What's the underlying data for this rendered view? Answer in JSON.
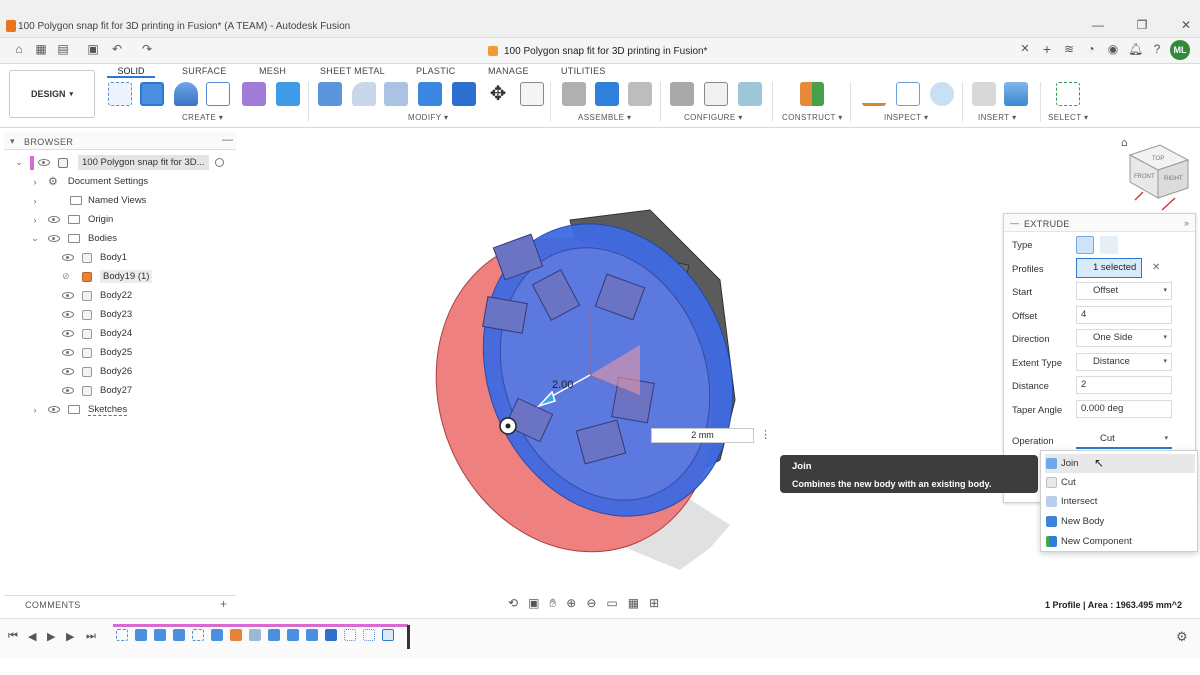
{
  "window": {
    "title": "100 Polygon snap fit for 3D printing in Fusion* (A TEAM) - Autodesk Fusion",
    "document_tab": "100 Polygon snap fit for 3D printing in Fusion*",
    "user_initials": "ML"
  },
  "toolbar": {
    "workspace_label": "DESIGN",
    "tabs": [
      "SOLID",
      "SURFACE",
      "MESH",
      "SHEET METAL",
      "PLASTIC",
      "MANAGE",
      "UTILITIES"
    ],
    "groups": [
      "CREATE",
      "MODIFY",
      "ASSEMBLE",
      "CONFIGURE",
      "CONSTRUCT",
      "INSPECT",
      "INSERT",
      "SELECT"
    ]
  },
  "browser": {
    "title": "BROWSER",
    "root": "100 Polygon snap fit for 3D...",
    "items": [
      {
        "label": "Document Settings"
      },
      {
        "label": "Named Views"
      },
      {
        "label": "Origin"
      },
      {
        "label": "Bodies"
      },
      {
        "label": "Body1"
      },
      {
        "label": "Body19 (1)"
      },
      {
        "label": "Body22"
      },
      {
        "label": "Body23"
      },
      {
        "label": "Body24"
      },
      {
        "label": "Body25"
      },
      {
        "label": "Body26"
      },
      {
        "label": "Body27"
      },
      {
        "label": "Sketches"
      }
    ]
  },
  "viewport": {
    "dimension_label": "2.00",
    "distance_input": "2 mm",
    "status_text": "1 Profile | Area : 1963.495 mm^2",
    "viewcube_faces": [
      "TOP",
      "FRONT",
      "RIGHT"
    ]
  },
  "extrude": {
    "title": "EXTRUDE",
    "type_label": "Type",
    "profiles_label": "Profiles",
    "profiles_value": "1 selected",
    "start_label": "Start",
    "start_value": "Offset",
    "offset_label": "Offset",
    "offset_value": "4",
    "direction_label": "Direction",
    "direction_value": "One Side",
    "extent_label": "Extent Type",
    "extent_value": "Distance",
    "distance_label": "Distance",
    "distance_value": "2",
    "taper_label": "Taper Angle",
    "taper_value": "0.000 deg",
    "operation_label": "Operation",
    "operation_value": "Cut"
  },
  "operation_menu": {
    "items": [
      "Join",
      "Cut",
      "Intersect",
      "New Body",
      "New Component"
    ]
  },
  "tooltip": {
    "title": "Join",
    "description": "Combines the new body with an existing body."
  },
  "comments": {
    "title": "COMMENTS"
  },
  "colors": {
    "accent": "#2b7ad0",
    "body_blue": "#3a63d8",
    "cut_red": "#ee7d7d",
    "dark_body": "#555555"
  }
}
